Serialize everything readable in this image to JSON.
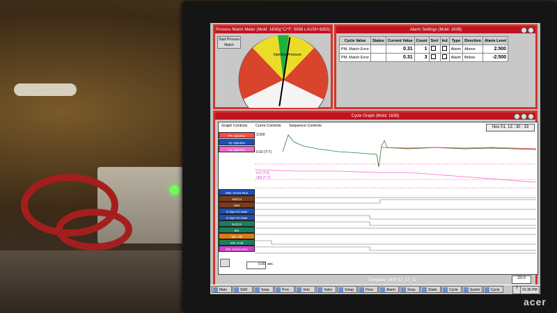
{
  "match_meter": {
    "title": "Process Match Meter (Mold: 1638)(°C/°F: 5658 LAUSH 6383)",
    "start_button": "Start Process Match",
    "gauge_label": "Injection Pressure",
    "gauge_value": 0.31
  },
  "alarm_settings": {
    "title": "Alarm Settings (Mold: 1638)",
    "columns": [
      "Cycle Value",
      "Status",
      "Current Value",
      "Count",
      "Sort",
      "Ind",
      "Type",
      "Direction",
      "Alarm Level"
    ],
    "rows": [
      {
        "name": "PM, Match Error",
        "status": "",
        "current": "0.31",
        "count": "1",
        "type": "Alarm",
        "direction": "Above",
        "level": "2.500"
      },
      {
        "name": "PM, Match Error",
        "status": "",
        "current": "0.31",
        "count": "3",
        "type": "Alarm",
        "direction": "Below",
        "level": "-2.500"
      }
    ]
  },
  "cycle_graph": {
    "title": "Cycle Graph (Mold: 1638)",
    "tabs": [
      "Graph Controls",
      "Curve Controls",
      "Sequence Controls"
    ],
    "datetime": "Nov 01, 13 : 30 : 33",
    "legend_top": [
      {
        "label": "PP, Injection",
        "color": "#ff4a4a"
      },
      {
        "label": "Vy, Injection",
        "color": "#1d4fb8"
      },
      {
        "label": "Vy, Injection",
        "color": "#ff66cc"
      }
    ],
    "y_labels": [
      "3,000",
      "0.02  (T-T)",
      "0.0  (T-0)",
      "250  (T-T)"
    ],
    "legend_bottom": [
      {
        "label": "SMI, Screw Run",
        "color": "#1d4fb8"
      },
      {
        "label": "MDCst",
        "color": "#7a3b1a"
      },
      {
        "label": "SMI",
        "color": "#7a3b1a"
      },
      {
        "label": "G.Opn #1 Gate",
        "color": "#1d4fb8"
      },
      {
        "label": "G.Opn #2 Gate",
        "color": "#1d4fb8"
      },
      {
        "label": "M.CLS",
        "color": "#18805a"
      },
      {
        "label": "BIJ",
        "color": "#18805a"
      },
      {
        "label": "MS, Fill",
        "color": "#e07a10"
      },
      {
        "label": "MS, Hold",
        "color": "#18805a"
      },
      {
        "label": "MS, Screw Run",
        "color": "#d040d0"
      }
    ],
    "time_value": "0.00",
    "time_unit": "sec.",
    "template": "Template: 1630 12_17_12",
    "zoom": "20.0"
  },
  "taskbar": {
    "items": [
      "Main",
      "Shift",
      "Sequ",
      "Proc",
      "Velo",
      "Valve",
      "Setup",
      "Flow",
      "Alarm",
      "Sequ",
      "Statis",
      "Cycle",
      "Summ",
      "Cycle"
    ],
    "help": "?",
    "clock": "01:36 PM"
  },
  "monitor_brand": "acer"
}
